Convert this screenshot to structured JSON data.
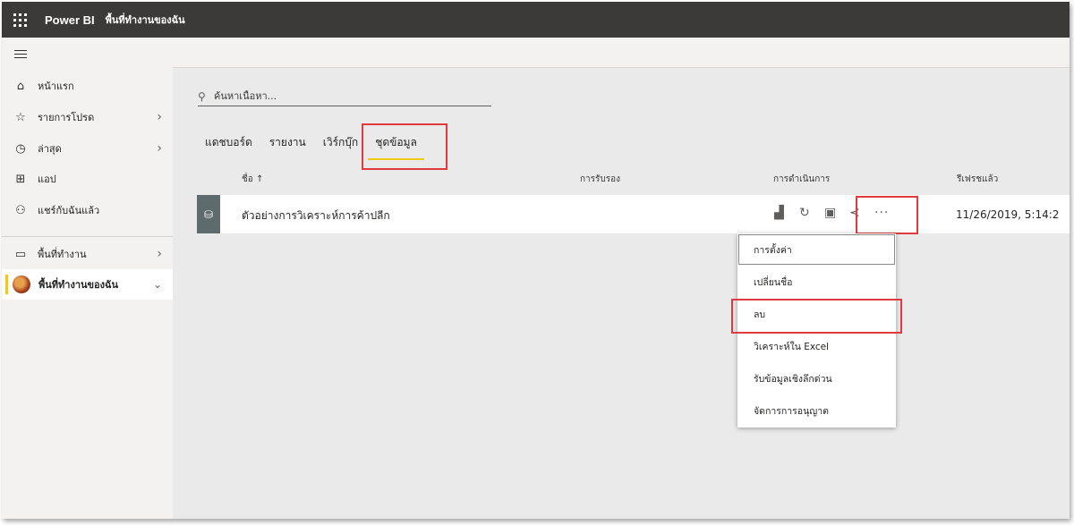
{
  "topbar": {
    "brand": "Power BI",
    "breadcrumb": "พื้นที่ทำงานของฉัน"
  },
  "sidebar": {
    "items": [
      {
        "label": "หน้าแรก",
        "icon": "home-icon"
      },
      {
        "label": "รายการโปรด",
        "icon": "star-icon"
      },
      {
        "label": "ล่าสุด",
        "icon": "clock-icon"
      },
      {
        "label": "แอป",
        "icon": "apps-icon"
      },
      {
        "label": "แชร์กับฉันแล้ว",
        "icon": "shared-icon"
      },
      {
        "label": "พื้นที่ทำงาน",
        "icon": "workspaces-icon"
      },
      {
        "label": "พื้นที่ทำงานของฉัน",
        "icon": "avatar"
      }
    ]
  },
  "search": {
    "placeholder": "ค้นหาเนื้อหา..."
  },
  "tabs": [
    "แดชบอร์ด",
    "รายงาน",
    "เวิร์กบุ๊ก",
    "ชุดข้อมูล"
  ],
  "active_tab": "ชุดข้อมูล",
  "columns": {
    "name": "ชื่อ ↑",
    "endorsement": "การรับรอง",
    "actions": "การดำเนินการ",
    "refreshed": "รีเฟรชแล้ว"
  },
  "dataset": {
    "name": "ตัวอย่างการวิเคราะห์การค้าปลีก",
    "refreshed": "11/26/2019, 5:14:2"
  },
  "menu": {
    "items": [
      "การตั้งค่า",
      "เปลี่ยนชื่อ",
      "ลบ",
      "วิเคราะห์ใน Excel",
      "รับข้อมูลเชิงลึกด่วน",
      "จัดการการอนุญาต"
    ]
  },
  "colors": {
    "topbar": "#3b3a39",
    "accent": "#f2c811",
    "highlight": "#e03a3e"
  }
}
